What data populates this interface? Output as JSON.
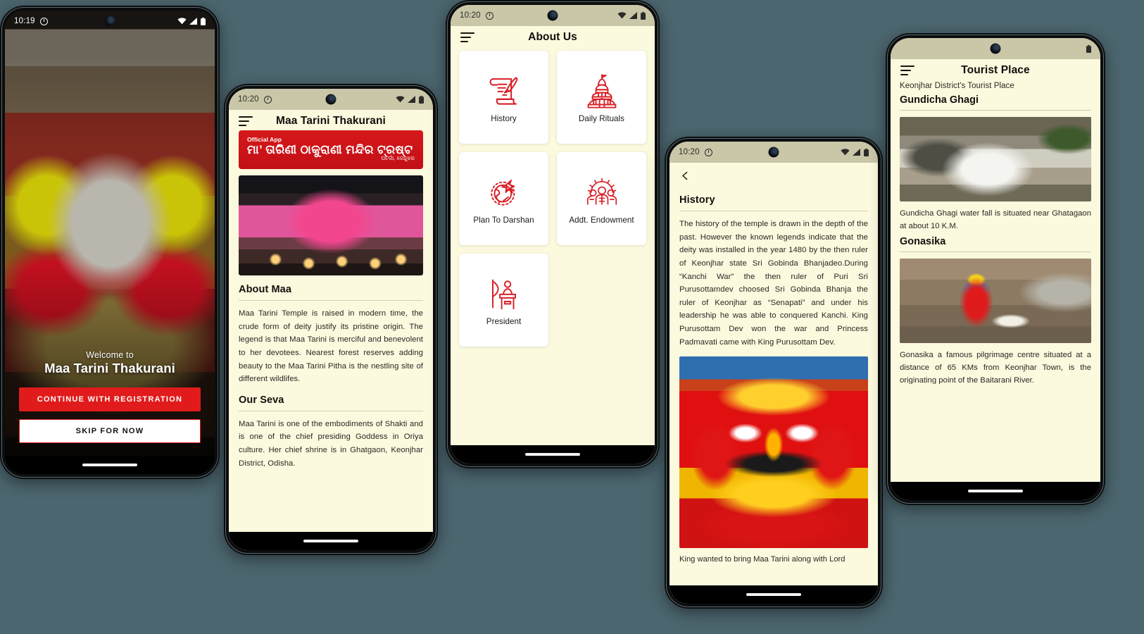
{
  "phones": {
    "splash": {
      "status": {
        "time": "10:19",
        "alarm_icon": "alarm-icon",
        "wifi_icon": "wifi-icon",
        "signal_icon": "signal-icon",
        "battery_icon": "battery-icon"
      },
      "welcome_small": "Welcome to",
      "welcome_large": "Maa Tarini Thakurani",
      "primary_button": "CONTINUE WITH REGISTRATION",
      "secondary_button": "SKIP FOR NOW",
      "accent_color": "#e11b1b"
    },
    "home": {
      "status": {
        "time": "10:20"
      },
      "appbar_title": "Maa Tarini Thakurani",
      "menu_icon": "hamburger-menu-icon",
      "banner": {
        "tag": "Official App",
        "main": "ମା’ ତାରିଣୀ ଠାକୁରାଣୀ ମନ୍ଦିର ଟ୍ରଷ୍ଟ",
        "footer": "ଘଟଗାଁ, କେନ୍ଦୁଝର",
        "bg_color": "#cc1217"
      },
      "hero_image": "temple-deity-decorated-photo",
      "sections": [
        {
          "title": "About Maa",
          "body": "Maa Tarini Temple is raised in modern time, the crude form of deity justify its pristine origin. The legend is that Maa Tarini is merciful and benevolent to her devotees. Nearest forest reserves adding beauty to the Maa Tarini Pitha is the nestling site of different wildlifes."
        },
        {
          "title": "Our Seva",
          "body": "Maa Tarini is one of the embodiments of Shakti and is one of the chief presiding Goddess in Oriya culture. Her chief shrine is in Ghatgaon, Keonjhar District, Odisha."
        }
      ]
    },
    "about_us": {
      "status": {
        "time": "10:20"
      },
      "appbar_title": "About Us",
      "menu_icon": "hamburger-menu-icon",
      "tiles": [
        {
          "label": "History",
          "icon": "scroll-quill-icon"
        },
        {
          "label": "Daily Rituals",
          "icon": "temple-icon"
        },
        {
          "label": "Plan To Darshan",
          "icon": "globe-airplane-icon"
        },
        {
          "label": "Addt. Endowment",
          "icon": "people-gear-icon"
        },
        {
          "label": "President",
          "icon": "podium-speaker-icon"
        }
      ],
      "icon_color": "#d91f26"
    },
    "history": {
      "status": {
        "time": "10:20"
      },
      "back_icon": "chevron-left-icon",
      "title": "History",
      "body": "The history of the temple is drawn in the depth of the past. However the known legends indicate that the deity was installed in the year 1480 by the then ruler of Keonjhar state Sri Gobinda Bhanjadeo.During “Kanchi War” the then ruler of Puri Sri Purusottamdev choosed Sri Gobinda Bhanja the ruler of Keonjhar as “Senapati” and under his leadership he was able to conquered Kanchi. King Purusottam Dev won the war and Princess Padmavati came with King Purusottam Dev.",
      "image": "maa-tarini-deity-photo",
      "caption": "King wanted to bring Maa Tarini along with Lord"
    },
    "tourist_place": {
      "appbar_title": "Tourist Place",
      "menu_icon": "hamburger-menu-icon",
      "subtitle": "Keonjhar District's Tourist Place",
      "places": [
        {
          "title": "Gundicha Ghagi",
          "image": "waterfall-photo",
          "description": "Gundicha Ghagi water fall is situated near Ghatagaon at about 10 K.M."
        },
        {
          "title": "Gonasika",
          "image": "gonasika-shrine-photo",
          "description": "Gonasika a famous pilgrimage centre situated at a distance of 65 KMs from Keonjhar Town, is the originating point of the Baitarani River."
        }
      ]
    }
  }
}
